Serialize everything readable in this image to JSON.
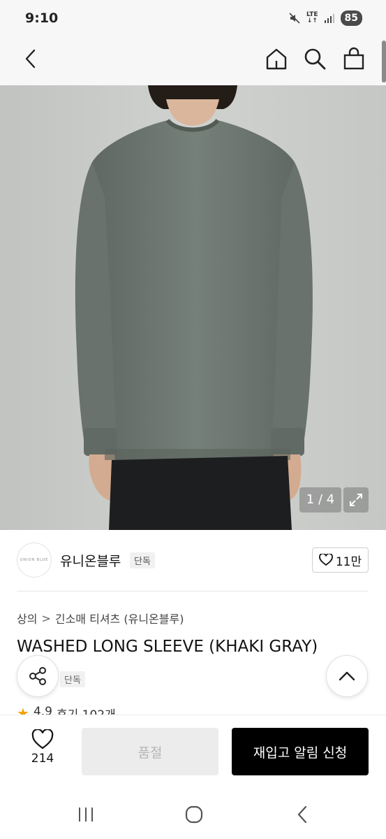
{
  "status_bar": {
    "time": "9:10",
    "network": "LTE",
    "battery": "85"
  },
  "icons": {
    "back": "chevron-left-icon",
    "home": "home-icon",
    "search": "search-icon",
    "cart": "shopping-bag-icon",
    "expand": "expand-icon",
    "heart": "heart-icon",
    "share": "share-icon",
    "scroll_top": "chevron-up-icon",
    "star": "star-icon"
  },
  "gallery": {
    "counter": "1 / 4"
  },
  "brand": {
    "logo_text": "UNION BLUE",
    "name": "유니온블루",
    "badge": "단독",
    "likes": "11만"
  },
  "breadcrumb": {
    "items": [
      "상의",
      "긴소매 티셔츠 (유니온블루)"
    ],
    "separator": ">"
  },
  "product": {
    "title": "WASHED LONG SLEEVE (KHAKI GRAY)",
    "exclusive_tag": "단독",
    "rating": "4.9",
    "reviews": "후기 102개"
  },
  "action_bar": {
    "wish_count": "214",
    "soldout_label": "품절",
    "restock_label": "재입고 알림 신청"
  },
  "colors": {
    "primary_button": "#000000",
    "disabled_button": "#ececec",
    "star": "#f2a100",
    "shirt": "#6f7872"
  }
}
